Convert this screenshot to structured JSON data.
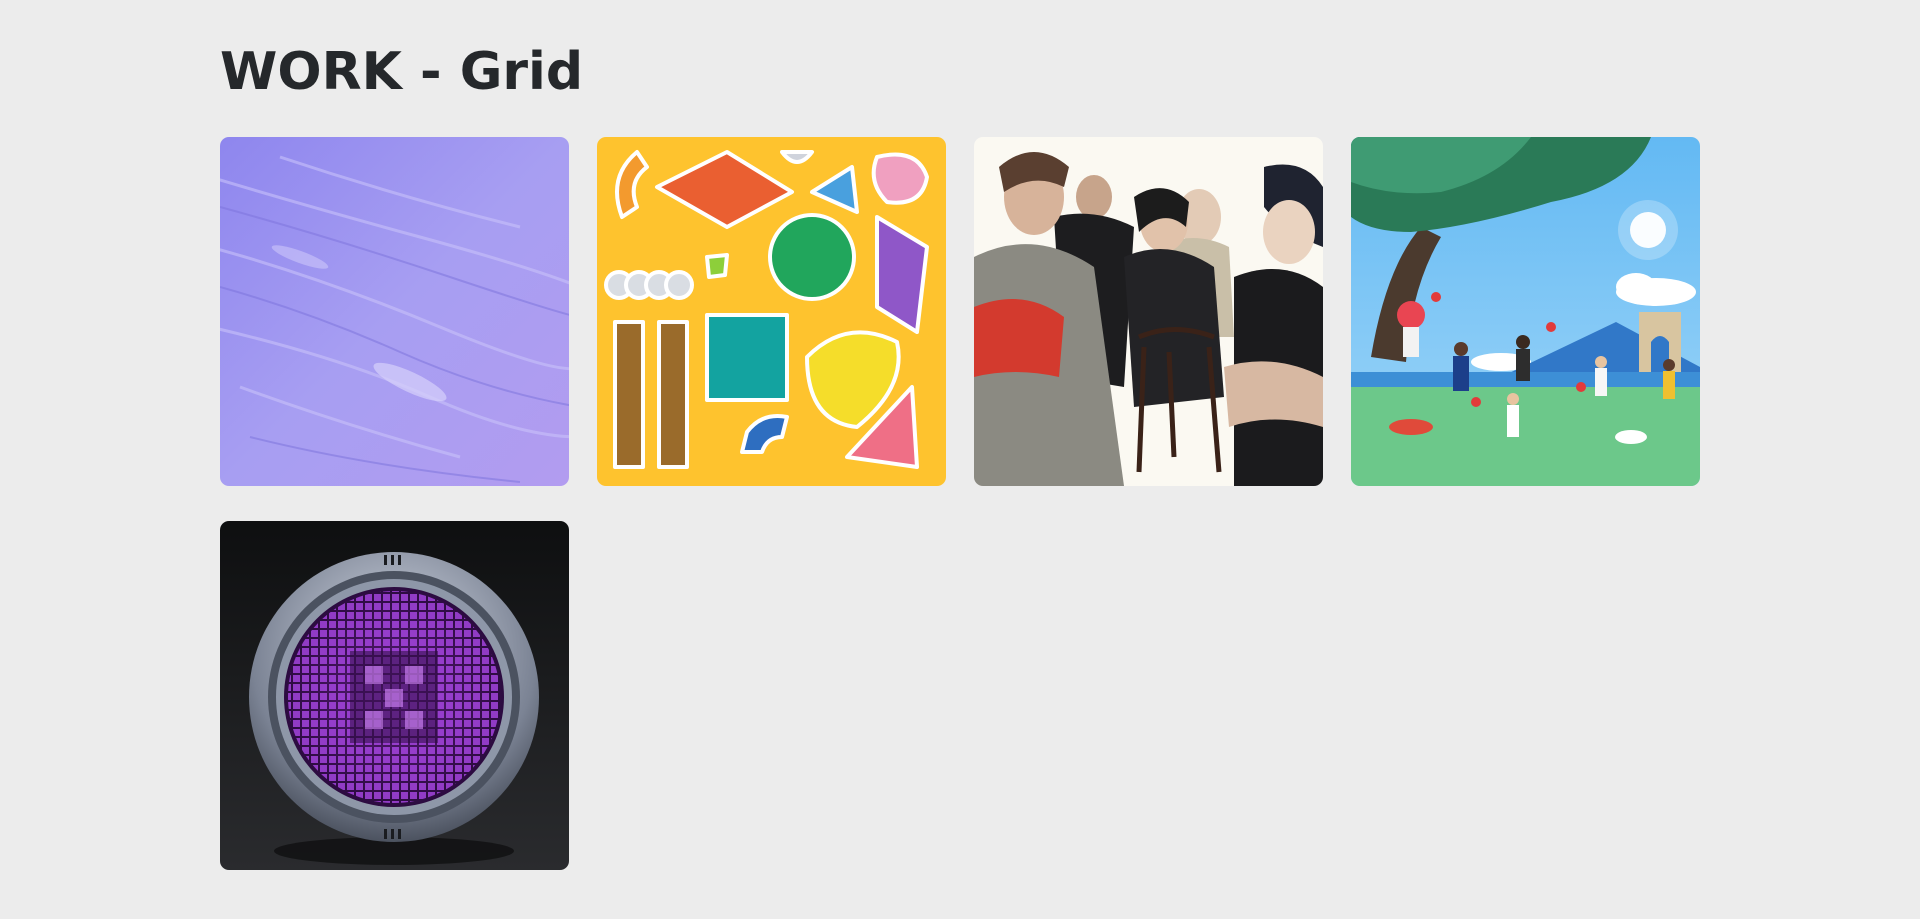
{
  "page": {
    "title": "WORK - Grid"
  },
  "grid": {
    "items": [
      {
        "name": "purple-paint-texture",
        "icon": "purple-brushstroke-texture"
      },
      {
        "name": "yellow-sticker-sheet",
        "icon": "colorful-sticker-illustrations"
      },
      {
        "name": "watercolor-group-portrait",
        "icon": "watercolor-people-illustration"
      },
      {
        "name": "park-tree-scene",
        "icon": "people-in-park-illustration"
      },
      {
        "name": "purple-pixel-dial",
        "icon": "round-dial-app-icon"
      }
    ]
  },
  "colors": {
    "background": "#ececec",
    "title": "#25282b",
    "lavender": "#a79ef0",
    "yellow": "#fec32e",
    "dial_purple": "#b14bf0",
    "dark": "#151618"
  }
}
